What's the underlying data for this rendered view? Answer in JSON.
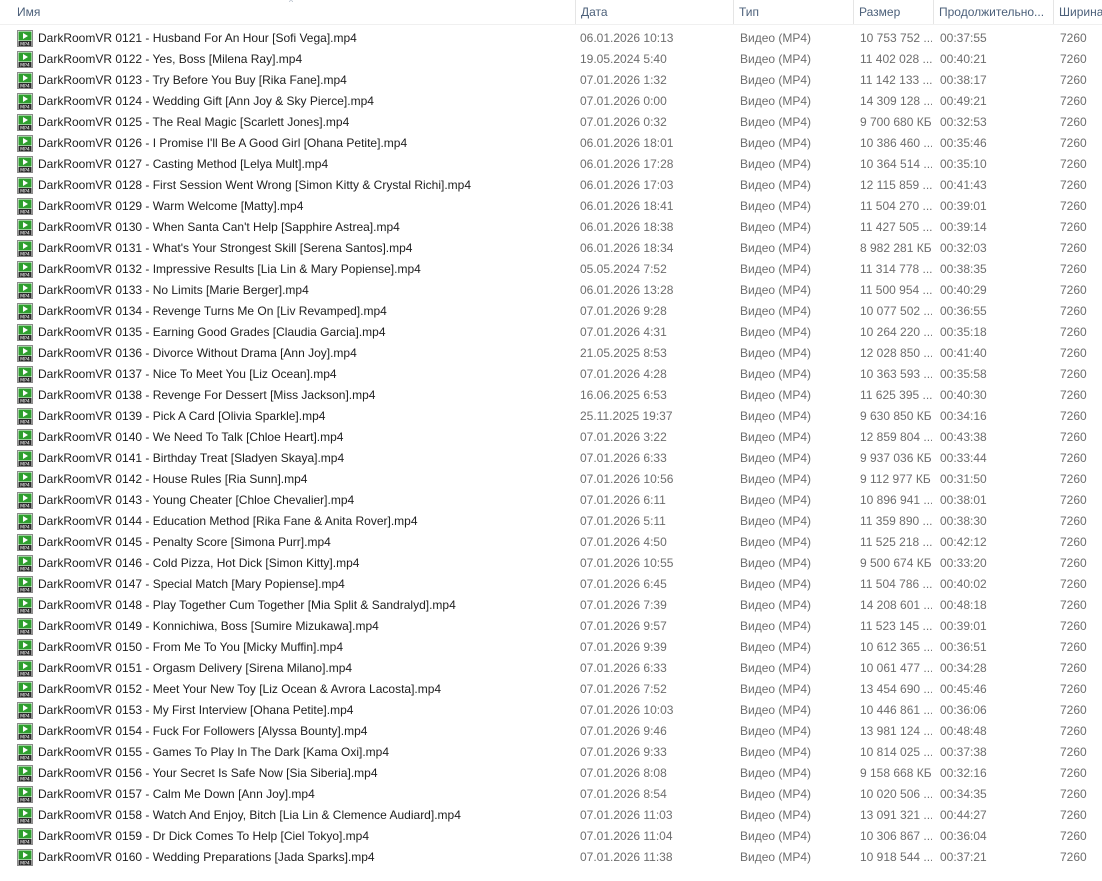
{
  "columns": {
    "name": "Имя",
    "date": "Дата",
    "type": "Тип",
    "size": "Размер",
    "duration": "Продолжительно...",
    "width": "Ширина"
  },
  "icon": {
    "name": "mp4-file-icon",
    "accent": "#2e9e2e",
    "badge_text": "MP4"
  },
  "files": [
    {
      "name": "DarkRoomVR 0121 - Husband For An Hour [Sofi Vega].mp4",
      "date": "06.01.2026 10:13",
      "type": "Видео (MP4)",
      "size": "10 753 752 ...",
      "duration": "00:37:55",
      "width": "7260"
    },
    {
      "name": "DarkRoomVR 0122 - Yes, Boss [Milena Ray].mp4",
      "date": "19.05.2024 5:40",
      "type": "Видео (MP4)",
      "size": "11 402 028 ...",
      "duration": "00:40:21",
      "width": "7260"
    },
    {
      "name": "DarkRoomVR 0123 - Try Before You Buy [Rika Fane].mp4",
      "date": "07.01.2026 1:32",
      "type": "Видео (MP4)",
      "size": "11 142 133 ...",
      "duration": "00:38:17",
      "width": "7260"
    },
    {
      "name": "DarkRoomVR 0124 - Wedding Gift [Ann Joy & Sky Pierce].mp4",
      "date": "07.01.2026 0:00",
      "type": "Видео (MP4)",
      "size": "14 309 128 ...",
      "duration": "00:49:21",
      "width": "7260"
    },
    {
      "name": "DarkRoomVR 0125 - The Real Magic [Scarlett Jones].mp4",
      "date": "07.01.2026 0:32",
      "type": "Видео (MP4)",
      "size": "9 700 680 КБ",
      "duration": "00:32:53",
      "width": "7260"
    },
    {
      "name": "DarkRoomVR 0126 - I Promise I'll Be A Good Girl [Ohana Petite].mp4",
      "date": "06.01.2026 18:01",
      "type": "Видео (MP4)",
      "size": "10 386 460 ...",
      "duration": "00:35:46",
      "width": "7260"
    },
    {
      "name": "DarkRoomVR 0127 - Casting Method [Lelya Mult].mp4",
      "date": "06.01.2026 17:28",
      "type": "Видео (MP4)",
      "size": "10 364 514 ...",
      "duration": "00:35:10",
      "width": "7260"
    },
    {
      "name": "DarkRoomVR 0128 - First Session Went Wrong [Simon Kitty & Crystal Richi].mp4",
      "date": "06.01.2026 17:03",
      "type": "Видео (MP4)",
      "size": "12 115 859 ...",
      "duration": "00:41:43",
      "width": "7260"
    },
    {
      "name": "DarkRoomVR 0129 - Warm Welcome [Matty].mp4",
      "date": "06.01.2026 18:41",
      "type": "Видео (MP4)",
      "size": "11 504 270 ...",
      "duration": "00:39:01",
      "width": "7260"
    },
    {
      "name": "DarkRoomVR 0130 - When Santa Can't Help [Sapphire Astrea].mp4",
      "date": "06.01.2026 18:38",
      "type": "Видео (MP4)",
      "size": "11 427 505 ...",
      "duration": "00:39:14",
      "width": "7260"
    },
    {
      "name": "DarkRoomVR 0131 - What's Your Strongest Skill [Serena Santos].mp4",
      "date": "06.01.2026 18:34",
      "type": "Видео (MP4)",
      "size": "8 982 281 КБ",
      "duration": "00:32:03",
      "width": "7260"
    },
    {
      "name": "DarkRoomVR 0132 - Impressive Results [Lia Lin & Mary Popiense].mp4",
      "date": "05.05.2024 7:52",
      "type": "Видео (MP4)",
      "size": "11 314 778 ...",
      "duration": "00:38:35",
      "width": "7260"
    },
    {
      "name": "DarkRoomVR 0133 - No Limits [Marie Berger].mp4",
      "date": "06.01.2026 13:28",
      "type": "Видео (MP4)",
      "size": "11 500 954 ...",
      "duration": "00:40:29",
      "width": "7260"
    },
    {
      "name": "DarkRoomVR 0134 - Revenge Turns Me On [Liv Revamped].mp4",
      "date": "07.01.2026 9:28",
      "type": "Видео (MP4)",
      "size": "10 077 502 ...",
      "duration": "00:36:55",
      "width": "7260"
    },
    {
      "name": "DarkRoomVR 0135 - Earning Good Grades [Claudia Garcia].mp4",
      "date": "07.01.2026 4:31",
      "type": "Видео (MP4)",
      "size": "10 264 220 ...",
      "duration": "00:35:18",
      "width": "7260"
    },
    {
      "name": "DarkRoomVR 0136 - Divorce Without Drama [Ann Joy].mp4",
      "date": "21.05.2025 8:53",
      "type": "Видео (MP4)",
      "size": "12 028 850 ...",
      "duration": "00:41:40",
      "width": "7260"
    },
    {
      "name": "DarkRoomVR 0137 - Nice To Meet You [Liz Ocean].mp4",
      "date": "07.01.2026 4:28",
      "type": "Видео (MP4)",
      "size": "10 363 593 ...",
      "duration": "00:35:58",
      "width": "7260"
    },
    {
      "name": "DarkRoomVR 0138 - Revenge For Dessert [Miss Jackson].mp4",
      "date": "16.06.2025 6:53",
      "type": "Видео (MP4)",
      "size": "11 625 395 ...",
      "duration": "00:40:30",
      "width": "7260"
    },
    {
      "name": "DarkRoomVR 0139 - Pick A Card [Olivia Sparkle].mp4",
      "date": "25.11.2025 19:37",
      "type": "Видео (MP4)",
      "size": "9 630 850 КБ",
      "duration": "00:34:16",
      "width": "7260"
    },
    {
      "name": "DarkRoomVR 0140 - We Need To Talk [Chloe Heart].mp4",
      "date": "07.01.2026 3:22",
      "type": "Видео (MP4)",
      "size": "12 859 804 ...",
      "duration": "00:43:38",
      "width": "7260"
    },
    {
      "name": "DarkRoomVR 0141 - Birthday Treat [Sladyen Skaya].mp4",
      "date": "07.01.2026 6:33",
      "type": "Видео (MP4)",
      "size": "9 937 036 КБ",
      "duration": "00:33:44",
      "width": "7260"
    },
    {
      "name": "DarkRoomVR 0142 - House Rules [Ria Sunn].mp4",
      "date": "07.01.2026 10:56",
      "type": "Видео (MP4)",
      "size": "9 112 977 КБ",
      "duration": "00:31:50",
      "width": "7260"
    },
    {
      "name": "DarkRoomVR 0143 - Young Cheater [Chloe Chevalier].mp4",
      "date": "07.01.2026 6:11",
      "type": "Видео (MP4)",
      "size": "10 896 941 ...",
      "duration": "00:38:01",
      "width": "7260"
    },
    {
      "name": "DarkRoomVR 0144 - Education Method [Rika Fane & Anita Rover].mp4",
      "date": "07.01.2026 5:11",
      "type": "Видео (MP4)",
      "size": "11 359 890 ...",
      "duration": "00:38:30",
      "width": "7260"
    },
    {
      "name": "DarkRoomVR 0145 - Penalty Score [Simona Purr].mp4",
      "date": "07.01.2026 4:50",
      "type": "Видео (MP4)",
      "size": "11 525 218 ...",
      "duration": "00:42:12",
      "width": "7260"
    },
    {
      "name": "DarkRoomVR 0146 - Cold Pizza, Hot Dick [Simon Kitty].mp4",
      "date": "07.01.2026 10:55",
      "type": "Видео (MP4)",
      "size": "9 500 674 КБ",
      "duration": "00:33:20",
      "width": "7260"
    },
    {
      "name": "DarkRoomVR 0147 - Special Match [Mary Popiense].mp4",
      "date": "07.01.2026 6:45",
      "type": "Видео (MP4)",
      "size": "11 504 786 ...",
      "duration": "00:40:02",
      "width": "7260"
    },
    {
      "name": "DarkRoomVR 0148 - Play Together Cum Together [Mia Split & Sandralyd].mp4",
      "date": "07.01.2026 7:39",
      "type": "Видео (MP4)",
      "size": "14 208 601 ...",
      "duration": "00:48:18",
      "width": "7260"
    },
    {
      "name": "DarkRoomVR 0149 - Konnichiwa, Boss [Sumire Mizukawa].mp4",
      "date": "07.01.2026 9:57",
      "type": "Видео (MP4)",
      "size": "11 523 145 ...",
      "duration": "00:39:01",
      "width": "7260"
    },
    {
      "name": "DarkRoomVR 0150 - From Me To You [Micky Muffin].mp4",
      "date": "07.01.2026 9:39",
      "type": "Видео (MP4)",
      "size": "10 612 365 ...",
      "duration": "00:36:51",
      "width": "7260"
    },
    {
      "name": "DarkRoomVR 0151 - Orgasm Delivery [Sirena Milano].mp4",
      "date": "07.01.2026 6:33",
      "type": "Видео (MP4)",
      "size": "10 061 477 ...",
      "duration": "00:34:28",
      "width": "7260"
    },
    {
      "name": "DarkRoomVR 0152 - Meet Your New Toy [Liz Ocean & Avrora Lacosta].mp4",
      "date": "07.01.2026 7:52",
      "type": "Видео (MP4)",
      "size": "13 454 690 ...",
      "duration": "00:45:46",
      "width": "7260"
    },
    {
      "name": "DarkRoomVR 0153 - My First Interview [Ohana Petite].mp4",
      "date": "07.01.2026 10:03",
      "type": "Видео (MP4)",
      "size": "10 446 861 ...",
      "duration": "00:36:06",
      "width": "7260"
    },
    {
      "name": "DarkRoomVR 0154 - Fuck For Followers [Alyssa Bounty].mp4",
      "date": "07.01.2026 9:46",
      "type": "Видео (MP4)",
      "size": "13 981 124 ...",
      "duration": "00:48:48",
      "width": "7260"
    },
    {
      "name": "DarkRoomVR 0155 - Games To Play In The Dark [Kama Oxi].mp4",
      "date": "07.01.2026 9:33",
      "type": "Видео (MP4)",
      "size": "10 814 025 ...",
      "duration": "00:37:38",
      "width": "7260"
    },
    {
      "name": "DarkRoomVR 0156 - Your Secret Is Safe Now [Sia Siberia].mp4",
      "date": "07.01.2026 8:08",
      "type": "Видео (MP4)",
      "size": "9 158 668 КБ",
      "duration": "00:32:16",
      "width": "7260"
    },
    {
      "name": "DarkRoomVR 0157 - Calm Me Down [Ann Joy].mp4",
      "date": "07.01.2026 8:54",
      "type": "Видео (MP4)",
      "size": "10 020 506 ...",
      "duration": "00:34:35",
      "width": "7260"
    },
    {
      "name": "DarkRoomVR 0158 - Watch And Enjoy, Bitch [Lia Lin & Clemence Audiard].mp4",
      "date": "07.01.2026 11:03",
      "type": "Видео (MP4)",
      "size": "13 091 321 ...",
      "duration": "00:44:27",
      "width": "7260"
    },
    {
      "name": "DarkRoomVR 0159 - Dr Dick Comes To Help [Ciel Tokyo].mp4",
      "date": "07.01.2026 11:04",
      "type": "Видео (MP4)",
      "size": "10 306 867 ...",
      "duration": "00:36:04",
      "width": "7260"
    },
    {
      "name": "DarkRoomVR 0160 - Wedding Preparations [Jada Sparks].mp4",
      "date": "07.01.2026 11:38",
      "type": "Видео (MP4)",
      "size": "10 918 544 ...",
      "duration": "00:37:21",
      "width": "7260"
    }
  ]
}
